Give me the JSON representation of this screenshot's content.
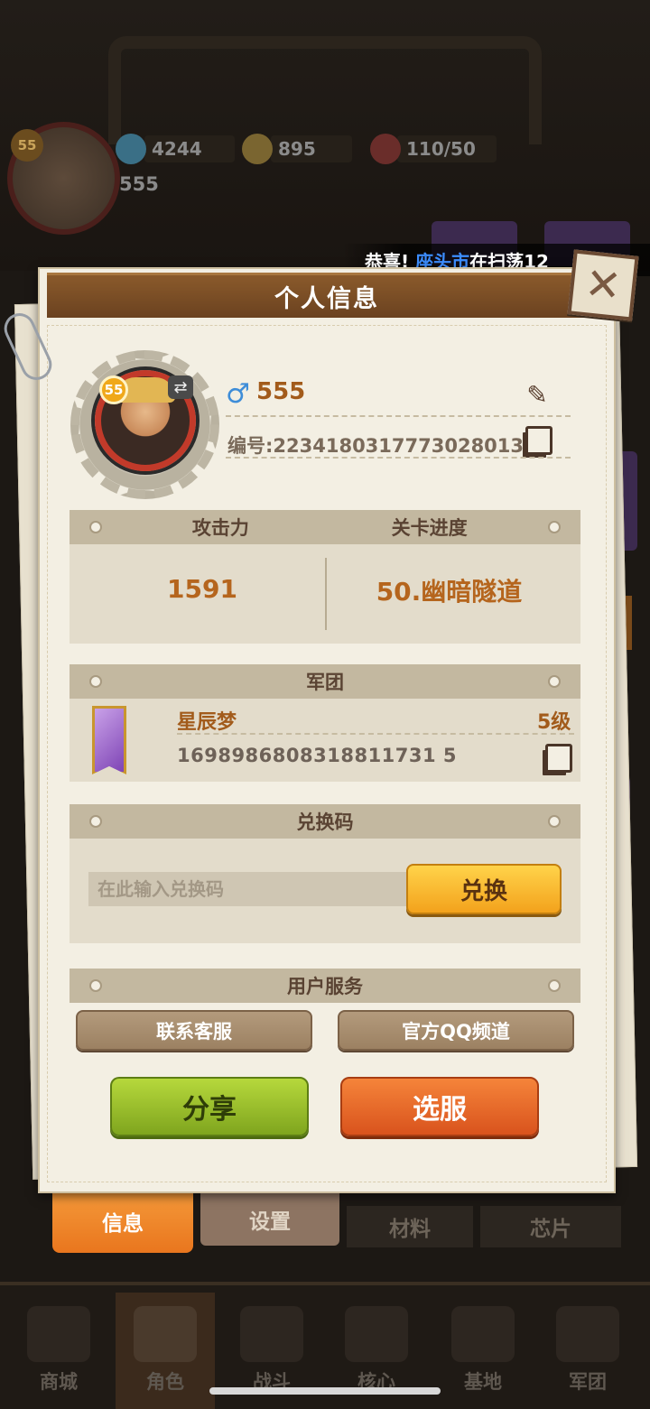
{
  "hud": {
    "level": "55",
    "player_name": "555",
    "gems": "4244",
    "coins": "895",
    "stamina": "110/50"
  },
  "notice": {
    "prefix": "恭喜!",
    "city": "座头市",
    "suffix": "在扫荡12"
  },
  "modal": {
    "title": "个人信息",
    "level": "55",
    "name": "555",
    "uid_label": "编号:2234180317773028013",
    "stats": {
      "attack_label": "攻击力",
      "progress_label": "关卡进度",
      "attack_value": "1591",
      "progress_value": "50.幽暗隧道"
    },
    "legion": {
      "header": "军团",
      "name": "星辰梦",
      "level": "5级",
      "id": "1698986808318811731 5"
    },
    "redeem": {
      "header": "兑换码",
      "placeholder": "在此输入兑换码",
      "button": "兑换"
    },
    "service": {
      "header": "用户服务",
      "contact": "联系客服",
      "qq": "官方QQ频道"
    },
    "share_button": "分享",
    "server_button": "选服"
  },
  "subtabs": [
    "信息",
    "设置",
    "材料",
    "芯片"
  ],
  "bottom_nav": [
    "商城",
    "角色",
    "战斗",
    "核心",
    "基地",
    "军团"
  ]
}
